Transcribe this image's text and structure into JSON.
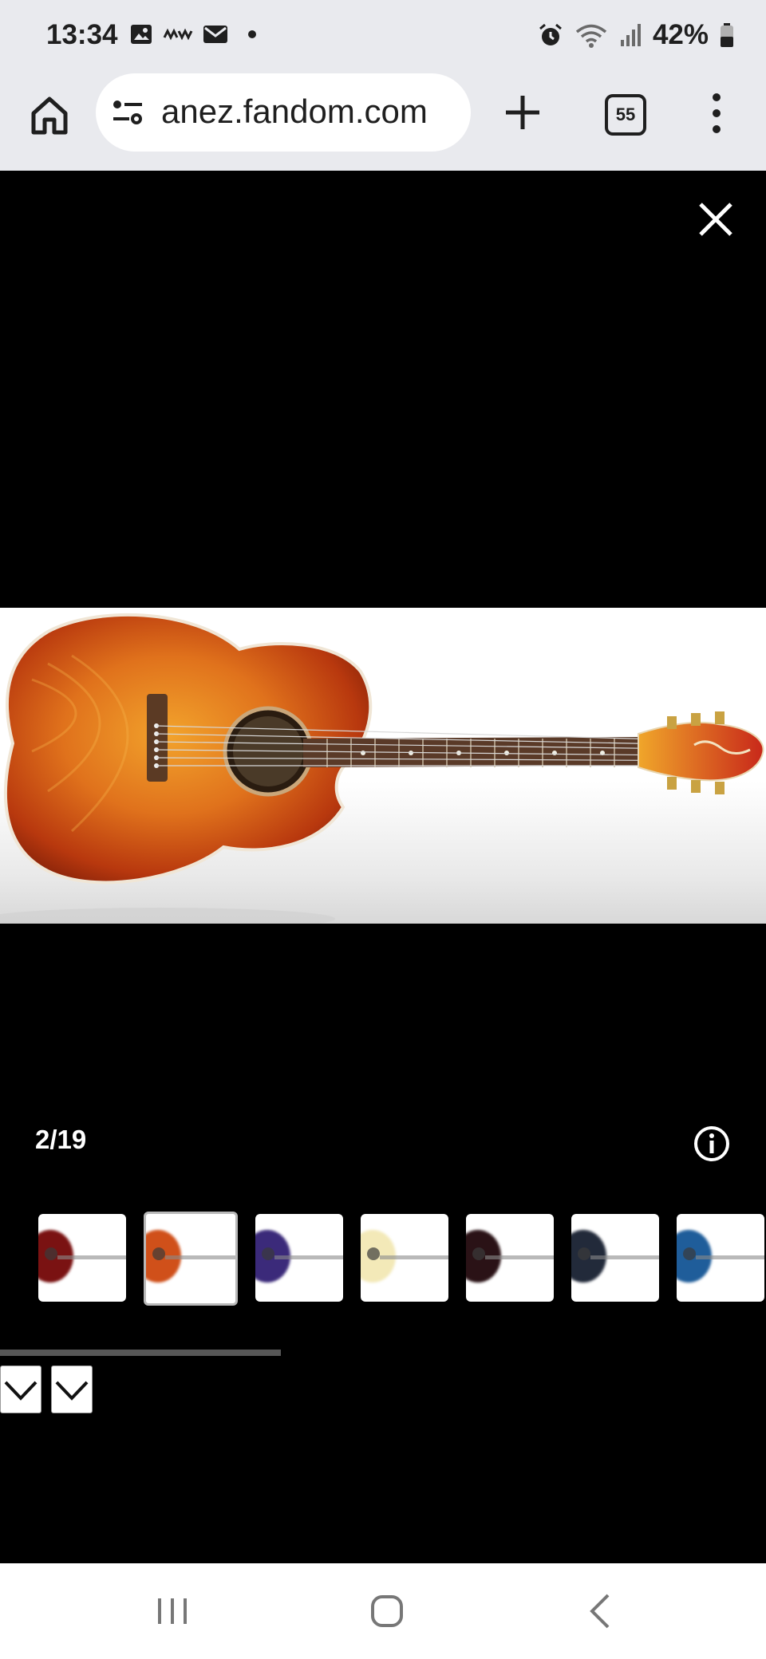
{
  "status_bar": {
    "time": "13:34",
    "battery": "42%",
    "icons": [
      "gallery-icon",
      "voicemail-icon",
      "mail-icon",
      "dot-icon",
      "alarm-icon",
      "wifi-icon",
      "signal-icon",
      "battery-icon"
    ]
  },
  "browser": {
    "url": "anez.fandom.com",
    "tab_count": "55",
    "icons": [
      "home-icon",
      "site-settings-icon",
      "new-tab-icon",
      "menu-icon"
    ]
  },
  "viewer": {
    "counter": "2/19",
    "current_index": 2,
    "total": 19,
    "thumbnails": [
      {
        "color": "#7a1212",
        "selected": false
      },
      {
        "color": "#d0501a",
        "selected": true
      },
      {
        "color": "#3b2a7a",
        "selected": false
      },
      {
        "color": "#f3e9b8",
        "selected": false
      },
      {
        "color": "#2a1216",
        "selected": false
      },
      {
        "color": "#222a3a",
        "selected": false
      },
      {
        "color": "#1f5d9a",
        "selected": false
      }
    ],
    "icons": [
      "close-icon",
      "info-icon",
      "chevron-down-icon"
    ]
  },
  "colors": {
    "chrome_bg": "#e9eaee",
    "viewer_bg": "#000000",
    "guitar_sunburst": "#d35a16"
  }
}
